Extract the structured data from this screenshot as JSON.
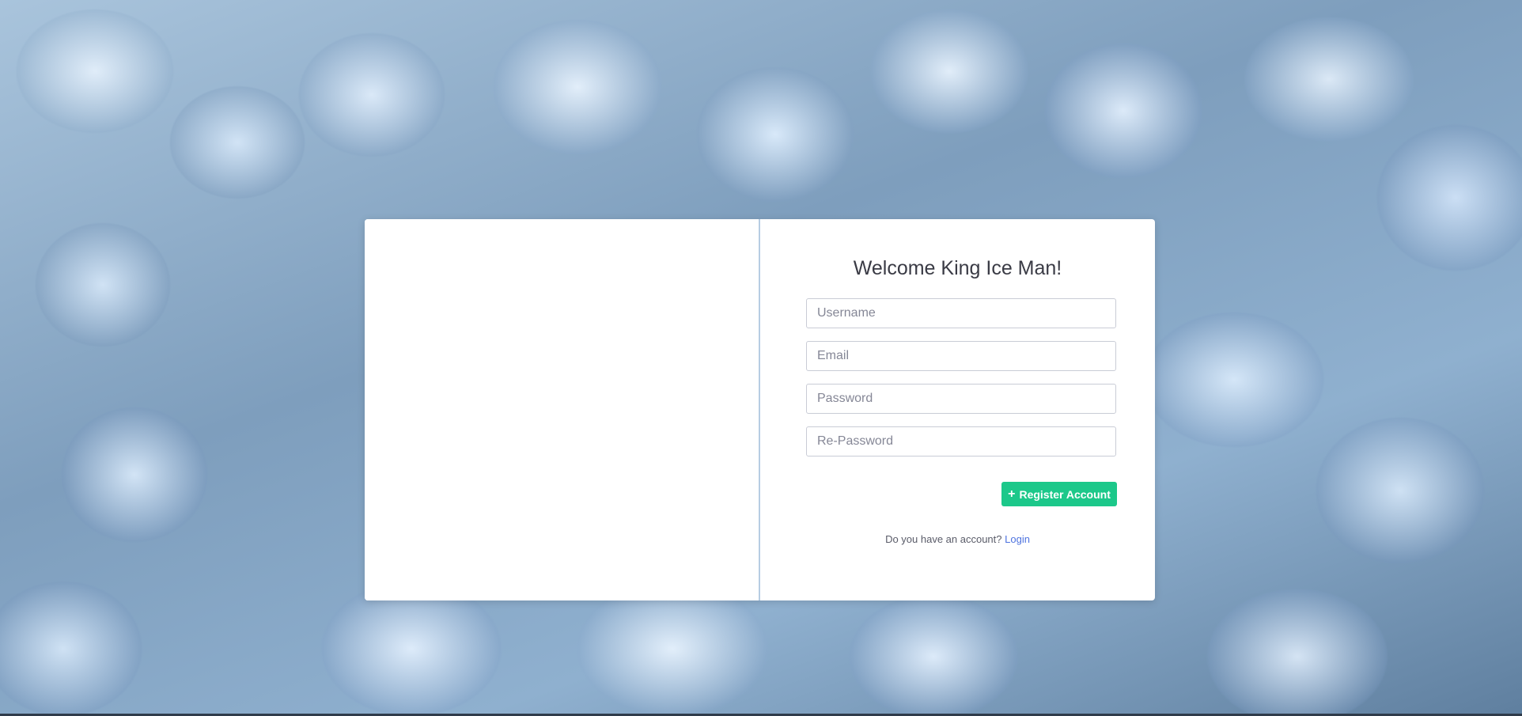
{
  "register": {
    "title": "Welcome King Ice Man!",
    "fields": {
      "username_placeholder": "Username",
      "email_placeholder": "Email",
      "password_placeholder": "Password",
      "repassword_placeholder": "Re-Password"
    },
    "register_button": {
      "icon": "plus-icon",
      "label": "Register Account"
    },
    "login_prompt": "Do you have an account?",
    "login_link": "Login"
  },
  "colors": {
    "accent": "#1cc88a",
    "link": "#4e73df",
    "title_text": "#3a3b45"
  }
}
